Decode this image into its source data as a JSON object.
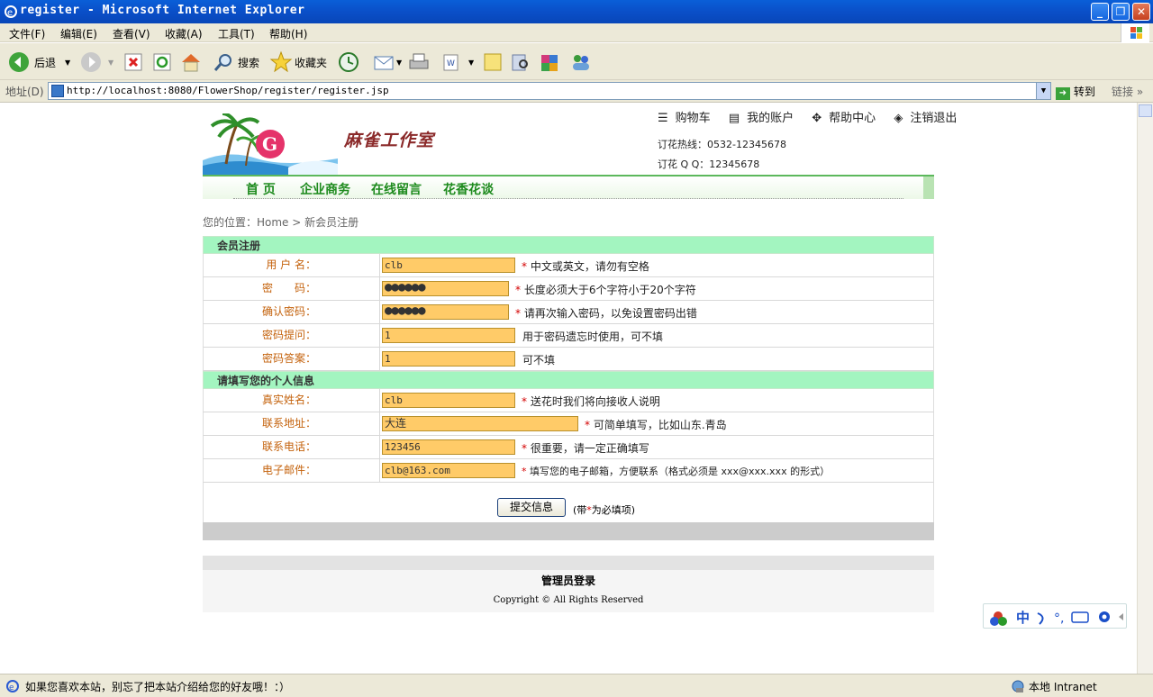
{
  "window": {
    "title": "register - Microsoft Internet Explorer",
    "minimize_icon": "minimize-icon",
    "maximize_icon": "restore-icon",
    "close_icon": "close-icon"
  },
  "menu": [
    "文件(F)",
    "编辑(E)",
    "查看(V)",
    "收藏(A)",
    "工具(T)",
    "帮助(H)"
  ],
  "toolbar": {
    "back_label": "后退",
    "search_label": "搜索",
    "favorites_label": "收藏夹"
  },
  "address": {
    "label": "地址(D)",
    "url": "http://localhost:8080/FlowerShop/register/register.jsp",
    "go_label": "转到",
    "links_label": "链接"
  },
  "site": {
    "brand": "麻雀工作室",
    "toplinks": [
      "购物车",
      "我的账户",
      "帮助中心",
      "注销退出"
    ],
    "hotline": "订花热线：0532-12345678",
    "qq": "订花 Q Q：12345678",
    "nav": [
      "首 页",
      "企业商务",
      "在线留言",
      "花香花谈"
    ],
    "breadcrumb": "您的位置：Home > 新会员注册"
  },
  "form": {
    "section1": "会员注册",
    "section2": "请填写您的个人信息",
    "rows": [
      {
        "label": "用 户 名：",
        "value": "clb",
        "required": true,
        "hint": "中文或英文，请勿有空格"
      },
      {
        "label": "密　　码：",
        "value": "●●●●●●",
        "required": true,
        "hint": "长度必须大于6个字符小于20个字符"
      },
      {
        "label": "确认密码：",
        "value": "●●●●●●",
        "required": true,
        "hint": "请再次输入密码，以免设置密码出错"
      },
      {
        "label": "密码提问：",
        "value": "1",
        "required": false,
        "hint": "用于密码遗忘时使用，可不填"
      },
      {
        "label": "密码答案：",
        "value": "1",
        "required": false,
        "hint": "可不填"
      },
      {
        "label": "真实姓名：",
        "value": "clb",
        "required": true,
        "hint": "送花时我们将向接收人说明"
      },
      {
        "label": "联系地址：",
        "value": "大连",
        "required": true,
        "hint": "可简单填写，比如山东.青岛"
      },
      {
        "label": "联系电话：",
        "value": "123456",
        "required": true,
        "hint": "很重要，请一定正确填写"
      },
      {
        "label": "电子邮件：",
        "value": "clb@163.com",
        "required": true,
        "hint": "填写您的电子邮箱，方便联系（格式必须是 xxx@xxx.xxx 的形式）"
      }
    ],
    "star": "*",
    "submit_label": "提交信息",
    "required_note_prefix": "(带",
    "required_note_suffix": "为必填项)"
  },
  "footer": {
    "admin_login": "管理员登录",
    "copyright": "Copyright © All Rights Reserved"
  },
  "statusbar": {
    "message": "如果您喜欢本站，别忘了把本站介绍给您的好友哦！：）",
    "zone": "本地 Intranet"
  }
}
